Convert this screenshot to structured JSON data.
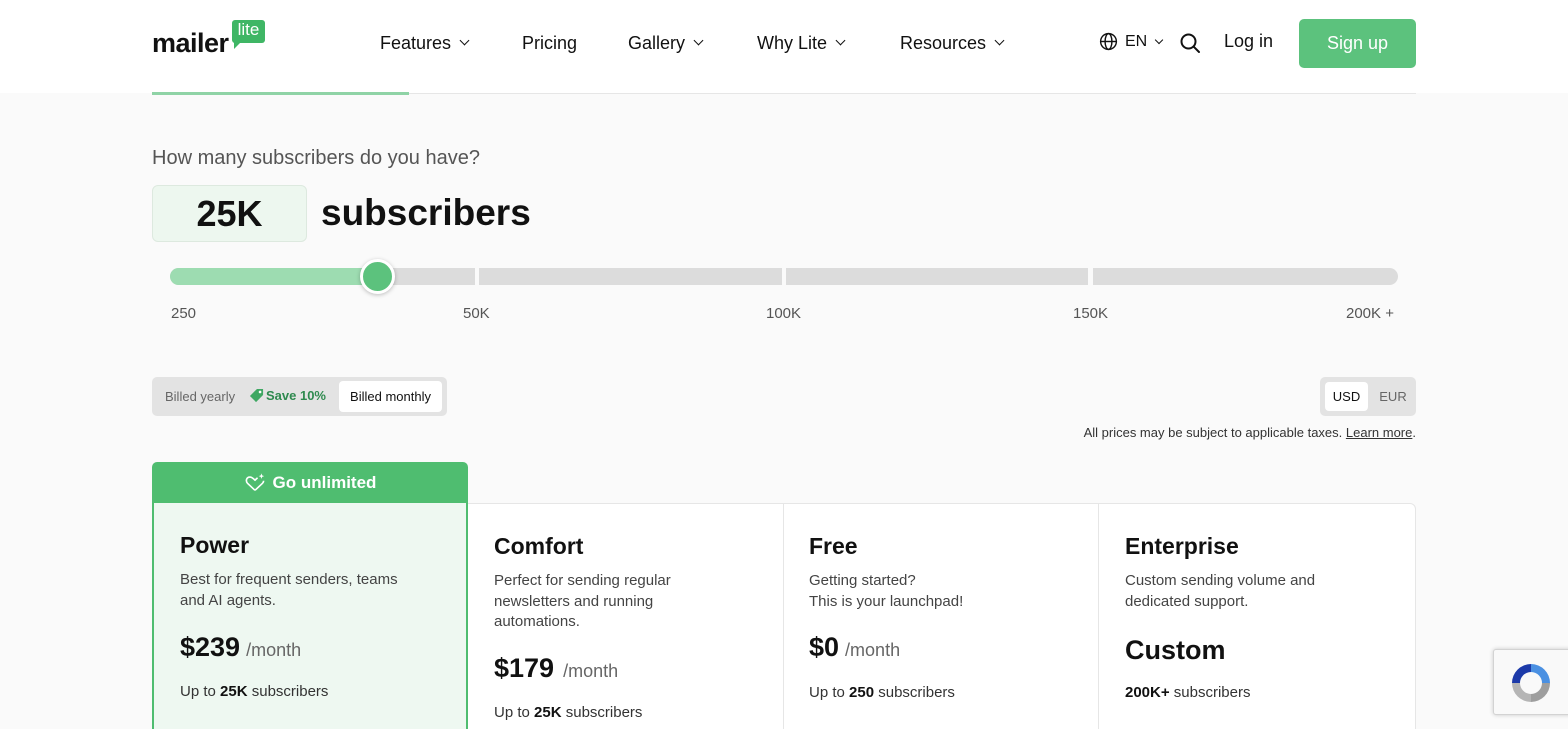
{
  "header": {
    "logo_text": "mailer",
    "logo_badge": "lite",
    "nav": [
      {
        "label": "Features",
        "has_dropdown": true
      },
      {
        "label": "Pricing",
        "has_dropdown": false
      },
      {
        "label": "Gallery",
        "has_dropdown": true
      },
      {
        "label": "Why Lite",
        "has_dropdown": true
      },
      {
        "label": "Resources",
        "has_dropdown": true
      }
    ],
    "language": "EN",
    "login_label": "Log in",
    "signup_label": "Sign up"
  },
  "subscribers": {
    "question": "How many subscribers do you have?",
    "value": "25K",
    "unit": "subscribers",
    "slider_fraction": 0.155,
    "ticks": [
      "250",
      "50K",
      "100K",
      "150K",
      "200K +"
    ]
  },
  "billing": {
    "yearly_label": "Billed yearly",
    "save_label": "Save 10%",
    "monthly_label": "Billed monthly",
    "selected": "monthly"
  },
  "currency": {
    "usd": "USD",
    "eur": "EUR",
    "selected": "USD"
  },
  "tax_note": {
    "text": "All prices may be subject to applicable taxes.",
    "link": "Learn more",
    "suffix": "."
  },
  "plans": {
    "banner": "Go unlimited",
    "items": [
      {
        "name": "Power",
        "desc": "Best for frequent senders, teams and AI agents.",
        "price": "$239",
        "per": "/month",
        "subs_prefix": "Up to",
        "subs_value": "25K",
        "subs_suffix": "subscribers"
      },
      {
        "name": "Comfort",
        "desc": "Perfect for sending regular newsletters and running automations.",
        "price": "$179",
        "per": "/month",
        "subs_prefix": "Up to",
        "subs_value": "25K",
        "subs_suffix": "subscribers"
      },
      {
        "name": "Free",
        "desc_line1": "Getting started?",
        "desc_line2": "This is your launchpad!",
        "price": "$0",
        "per": "/month",
        "subs_prefix": "Up to",
        "subs_value": "250",
        "subs_suffix": "subscribers"
      },
      {
        "name": "Enterprise",
        "desc": "Custom sending volume and dedicated support.",
        "price": "Custom",
        "subs_value": "200K+",
        "subs_suffix": "subscribers"
      }
    ]
  },
  "colors": {
    "brand_green": "#5cc27d",
    "banner_green": "#4fbd70",
    "slider_fill": "#9ddcb1"
  }
}
